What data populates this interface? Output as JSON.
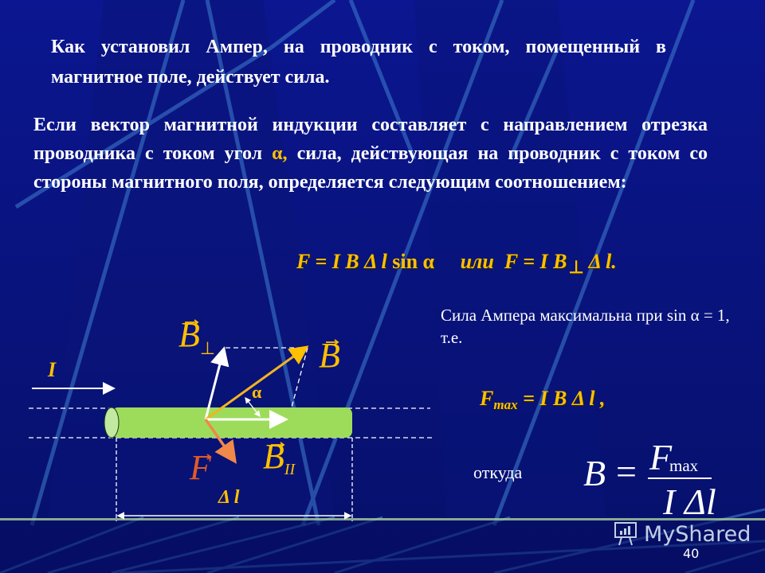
{
  "slide": {
    "number": "40",
    "colors": {
      "background": "#0a1585",
      "text": "#ffffff",
      "accent": "#ffc000",
      "force": "#e05a28",
      "conductor": "#9ddc5a"
    }
  },
  "paragraph1": "Как установил Ампер, на проводник с током, помещенный в магнитное поле, действует сила.",
  "paragraph2": {
    "before_alpha": "Если вектор магнитной индукции составляет с направлением отрезка проводника с током угол ",
    "alpha": "α,",
    "after_alpha": " сила, действующая на проводник с током со стороны магнитного поля, определяется следующим соотношением:"
  },
  "formula_main": {
    "left": "F = I B Δ l ",
    "sin": "sin α",
    "or": "или",
    "right_a": "F = I B",
    "perp": "⊥",
    "right_b": "Δ l."
  },
  "max_note": "Сила Ампера максимальна при sin α = 1, т.е.",
  "fmax": {
    "F": "F",
    "sub": "max",
    "rest": " = I B Δ l ,"
  },
  "otkuda": "откуда",
  "equation": {
    "lhs": "B",
    "equals": "=",
    "num": "F",
    "num_sub": "max",
    "den": "I Δl"
  },
  "diagram": {
    "current_label": "I",
    "b_perp_label": "B",
    "b_perp_sub": "⊥",
    "b_label": "B",
    "alpha_label": "α",
    "b_par_label": "B",
    "b_par_sub": "II",
    "force_label": "F",
    "length_label": "Δ l"
  },
  "watermark": {
    "text": "MyShared",
    "icon": "presentation-board-icon"
  }
}
